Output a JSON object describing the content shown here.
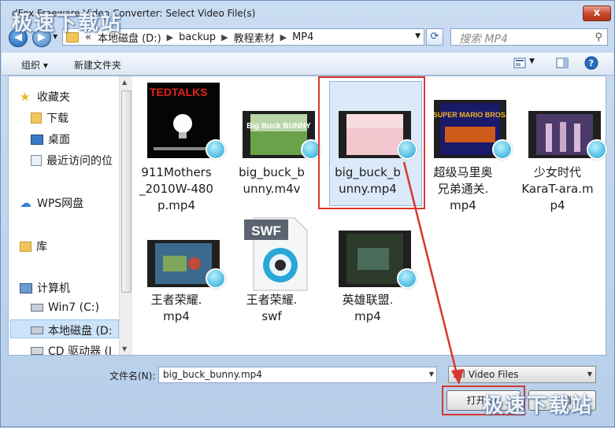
{
  "window": {
    "title": "dFox Freeware Video Converter: Select Video File(s)",
    "close_label": "x",
    "watermark": "极速下载站"
  },
  "nav": {
    "back_icon": "back-arrow-icon",
    "forward_icon": "forward-arrow-icon",
    "breadcrumb": [
      "«",
      "本地磁盘 (D:)",
      "backup",
      "教程素材",
      "MP4"
    ],
    "search_placeholder": "搜索 MP4"
  },
  "toolbar": {
    "organize_label": "组织 ▾",
    "new_folder_label": "新建文件夹"
  },
  "sidebar": {
    "items": [
      {
        "label": "收藏夹",
        "icon": "star-icon"
      },
      {
        "label": "下载",
        "icon": "folder-icon"
      },
      {
        "label": "桌面",
        "icon": "desktop-icon"
      },
      {
        "label": "最近访问的位",
        "icon": "recent-icon"
      },
      {
        "label": "WPS网盘",
        "icon": "cloud-icon"
      },
      {
        "label": "库",
        "icon": "library-icon"
      },
      {
        "label": "计算机",
        "icon": "computer-icon"
      },
      {
        "label": "Win7 (C:)",
        "icon": "drive-icon"
      },
      {
        "label": "本地磁盘 (D:",
        "icon": "drive-icon"
      },
      {
        "label": "CD 驱动器 (I",
        "icon": "cd-drive-icon"
      }
    ],
    "selected_index": 8
  },
  "files": [
    {
      "name": "911Mothers_2010W-480p.mp4",
      "lines": [
        "911Mothers",
        "_2010W-480",
        "p.mp4"
      ],
      "thumb_text": "TEDTALKS"
    },
    {
      "name": "big_buck_bunny.m4v",
      "lines": [
        "big_buck_b",
        "unny.m4v"
      ],
      "thumb_text": "Big Buck BUNNY"
    },
    {
      "name": "big_buck_bunny.mp4",
      "lines": [
        "big_buck_b",
        "unny.mp4"
      ],
      "selected": true
    },
    {
      "name": "超级马里奥兄弟通关.mp4",
      "lines": [
        "超级马里奥",
        "兄弟通关.",
        "mp4"
      ],
      "thumb_text": "SUPER MARIO BROS."
    },
    {
      "name": "少女时代KaraT-ara.mp4",
      "lines": [
        "少女时代",
        "KaraT-ara.m",
        "p4"
      ]
    },
    {
      "name": "王者荣耀.mp4",
      "lines": [
        "王者荣耀.",
        "mp4"
      ]
    },
    {
      "name": "王者荣耀.swf",
      "lines": [
        "王者荣耀.",
        "swf"
      ],
      "thumb_text": "SWF"
    },
    {
      "name": "英雄联盟.mp4",
      "lines": [
        "英雄联盟.",
        "mp4"
      ]
    }
  ],
  "bottom": {
    "filename_label": "文件名(N):",
    "filename_value": "big_buck_bunny.mp4",
    "filter_value": "All Video Files",
    "open_label": "打开(O)",
    "cancel_label": "取消"
  },
  "colors": {
    "annotation_red": "#d9362d",
    "selection_blue": "#dbe9f8"
  }
}
